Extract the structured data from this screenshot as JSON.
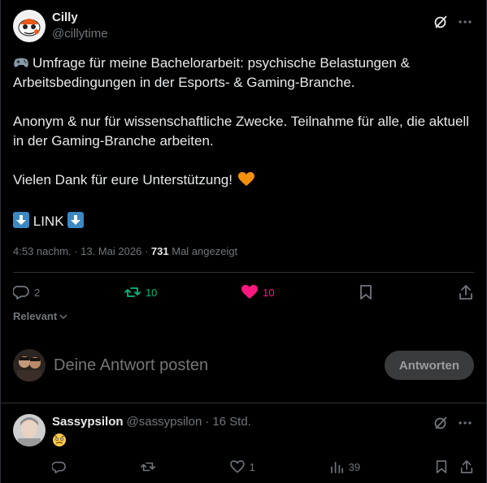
{
  "post": {
    "author_name": "Cilly",
    "author_handle": "@cillytime",
    "line1": "Umfrage für meine Bachelorarbeit: psychische Belastungen &",
    "line2": "Arbeitsbedingungen in der Esports- & Gaming-Branche.",
    "line3": "Anonym & nur für wissenschaftliche Zwecke. Teilnahme für alle, die aktuell",
    "line4": "in der Gaming-Branche arbeiten.",
    "line5": "Vielen Dank für eure Unterstützung!",
    "link_text": "LINK",
    "time": "4:53 nachm.",
    "separator": "·",
    "date": "13. Mai 2026",
    "views_count": "731",
    "views_label": "Mal angezeigt"
  },
  "actions": {
    "replies": "2",
    "reposts": "10",
    "likes": "10"
  },
  "sort": {
    "label": "Relevant"
  },
  "reply_box": {
    "placeholder": "Deine Antwort posten",
    "button_label": "Antworten"
  },
  "reply": {
    "author_name": "Sassypsilon",
    "author_handle": "@sassypsilon",
    "separator": "·",
    "time": "16 Std.",
    "likes": "1",
    "views": "39"
  },
  "colors": {
    "background": "#000000",
    "text": "#e7e9ea",
    "muted": "#71767b",
    "repost": "#00ba7c",
    "like": "#f91880",
    "divider": "#2f3336"
  },
  "icons": [
    "grok-icon",
    "more-icon",
    "reply-icon",
    "repost-icon",
    "heart-icon",
    "bookmark-icon",
    "share-icon",
    "views-icon",
    "chevron-down-icon",
    "gamepad-emoji",
    "orange-heart-emoji",
    "down-arrow-emoji",
    "nervous-face-emoji"
  ]
}
